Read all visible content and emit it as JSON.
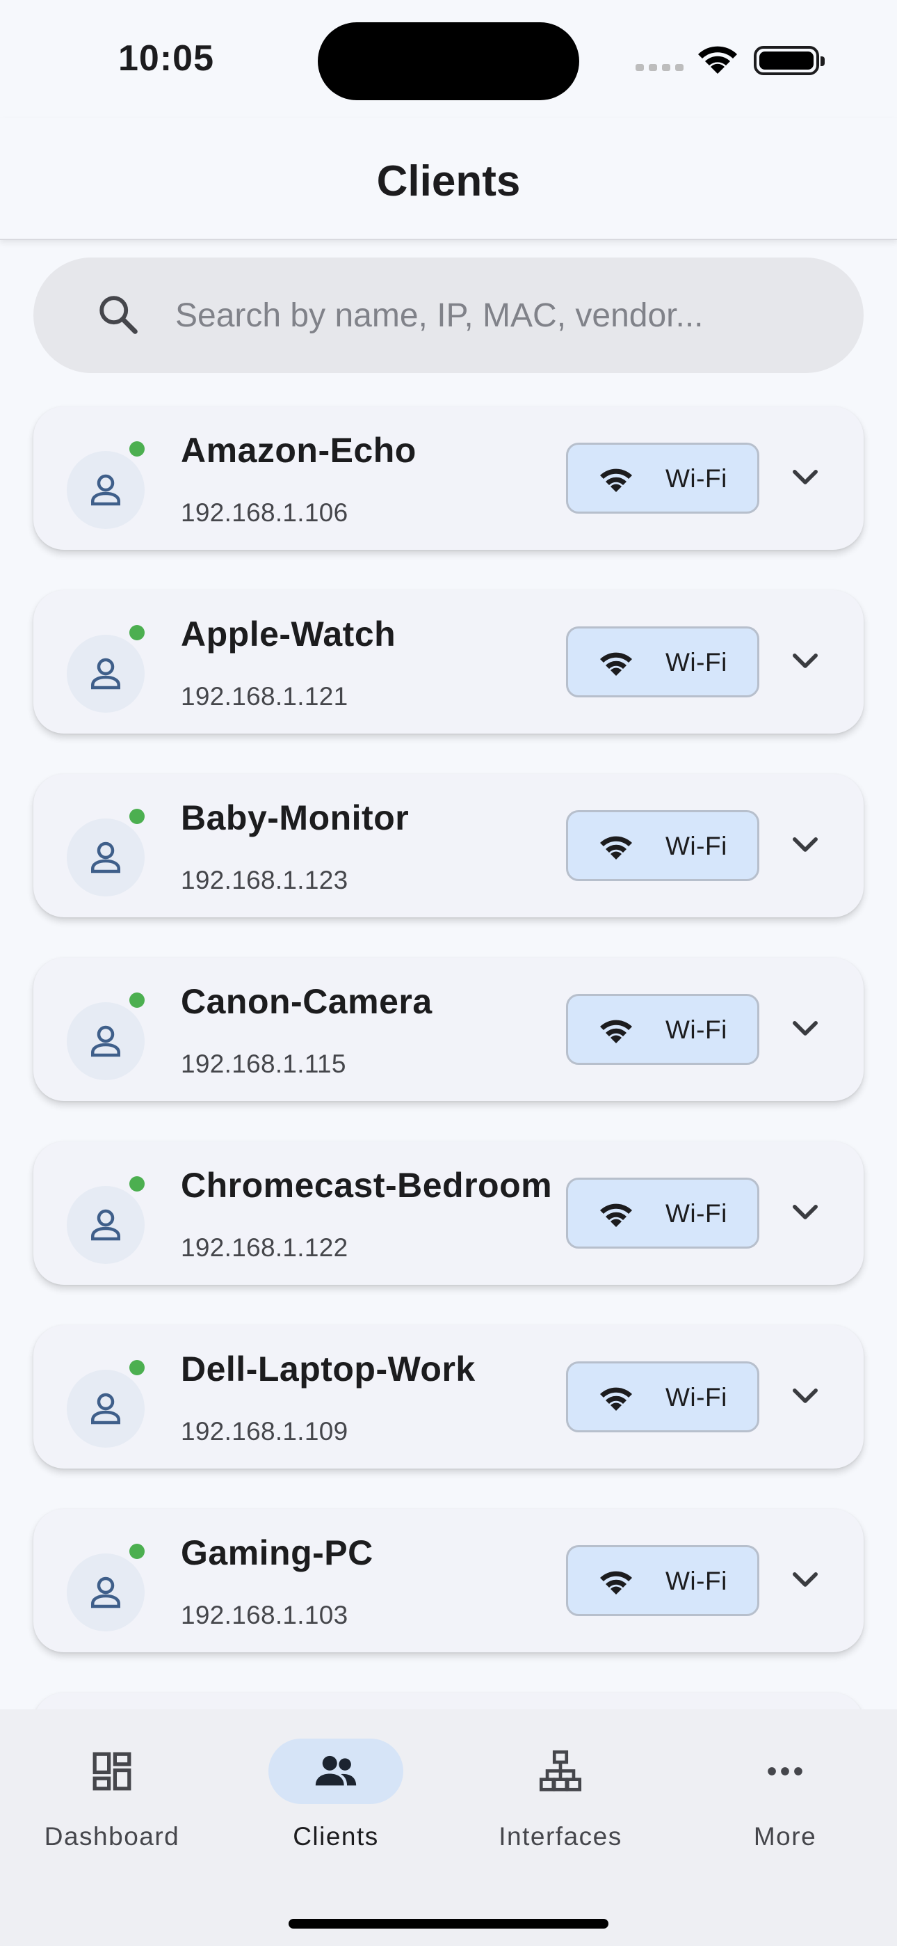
{
  "status_bar": {
    "time": "10:05"
  },
  "header": {
    "title": "Clients"
  },
  "search": {
    "placeholder": "Search by name, IP, MAC, vendor..."
  },
  "clients": [
    {
      "name": "Amazon-Echo",
      "ip": "192.168.1.106",
      "connection": "Wi-Fi",
      "status": "online"
    },
    {
      "name": "Apple-Watch",
      "ip": "192.168.1.121",
      "connection": "Wi-Fi",
      "status": "online"
    },
    {
      "name": "Baby-Monitor",
      "ip": "192.168.1.123",
      "connection": "Wi-Fi",
      "status": "online"
    },
    {
      "name": "Canon-Camera",
      "ip": "192.168.1.115",
      "connection": "Wi-Fi",
      "status": "online"
    },
    {
      "name": "Chromecast-Bedroom",
      "ip": "192.168.1.122",
      "connection": "Wi-Fi",
      "status": "online"
    },
    {
      "name": "Dell-Laptop-Work",
      "ip": "192.168.1.109",
      "connection": "Wi-Fi",
      "status": "online"
    },
    {
      "name": "Gaming-PC",
      "ip": "192.168.1.103",
      "connection": "Wi-Fi",
      "status": "online"
    }
  ],
  "colors": {
    "online": "#4caf50",
    "chip_bg": "#d6e6fb",
    "active_nav": "#d6e4f7",
    "avatar_icon": "#3f5f8a"
  },
  "nav": [
    {
      "label": "Dashboard",
      "icon": "dashboard-icon",
      "active": false
    },
    {
      "label": "Clients",
      "icon": "people-icon",
      "active": true
    },
    {
      "label": "Interfaces",
      "icon": "network-icon",
      "active": false
    },
    {
      "label": "More",
      "icon": "more-dots-icon",
      "active": false
    }
  ]
}
